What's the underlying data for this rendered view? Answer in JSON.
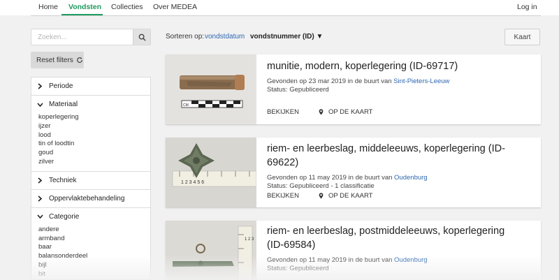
{
  "nav": {
    "home": "Home",
    "vondsten": "Vondsten",
    "collecties": "Collecties",
    "over": "Over MEDEA",
    "login": "Log in"
  },
  "sidebar": {
    "search_placeholder": "Zoeken...",
    "reset_label": "Reset filters",
    "filters": {
      "periode": "Periode",
      "materiaal": "Materiaal",
      "materiaal_items": [
        "koperlegering",
        "ijzer",
        "lood",
        "tin of loodtin",
        "goud",
        "zilver"
      ],
      "techniek": "Techniek",
      "oppervlakte": "Oppervlaktebehandeling",
      "categorie": "Categorie",
      "categorie_items": [
        "andere",
        "armband",
        "baar",
        "balansonderdeel",
        "bijl",
        "bit"
      ]
    }
  },
  "sort": {
    "label": "Sorteren op:",
    "option_date": "vondstdatum",
    "option_id": "vondstnummer (ID) ▼"
  },
  "map_button": "Kaart",
  "cards": [
    {
      "title": "munitie, modern, koperlegering (ID-69717)",
      "found_prefix": "Gevonden op 23 mar 2019 in de buurt van ",
      "location": "Sint-Pieters-Leeuw",
      "status": "Status: Gepubliceerd",
      "view": "BEKIJKEN",
      "map": "OP DE KAART"
    },
    {
      "title": "riem- en leerbeslag, middeleeuws, koperlegering (ID-69622)",
      "found_prefix": "Gevonden op 11 may 2019 in de buurt van ",
      "location": "Oudenburg",
      "status": "Status: Gepubliceerd - 1 classificatie",
      "view": "BEKIJKEN",
      "map": "OP DE KAART"
    },
    {
      "title_line1": "riem- en leerbeslag, postmiddeleeuws, koperlegering",
      "title_line2": "(ID-69584)",
      "found_prefix": "Gevonden op 11 may 2019 in de buurt van ",
      "location": "Oudenburg",
      "status": "Status: Gepubliceerd"
    }
  ],
  "image_labels": {
    "scale_cm": "CM",
    "ruler2_digits": "1 2 3 4 5 6",
    "ruler3_digits": "1 2 3"
  },
  "colors": {
    "accent_green": "#1f9b5f",
    "link_blue": "#2e67b1",
    "page_bg": "#f1f1f1"
  }
}
